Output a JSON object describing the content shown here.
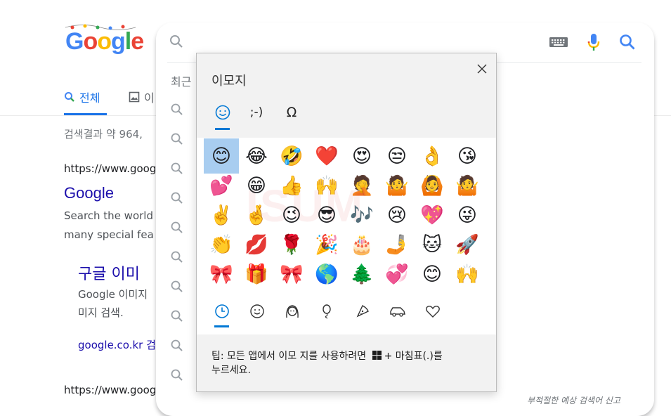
{
  "logo": {
    "letters": [
      "G",
      "o",
      "o",
      "g",
      "l",
      "e"
    ],
    "colors": [
      "#4285f4",
      "#ea4335",
      "#fbbc05",
      "#4285f4",
      "#34a853",
      "#ea4335"
    ]
  },
  "tabs": {
    "all": "전체",
    "images": "이"
  },
  "results": {
    "stats": "검색결과 약 964,",
    "url1": "https://www.goog",
    "title": "Google",
    "snippet1": "Search the world",
    "snippet2": "many special fea",
    "sub_title": "구글 이미",
    "sub_snippet1": "Google 이미지",
    "sub_snippet2": "미지 검색.",
    "sub_link": "google.co.kr 검",
    "url2": "https://www.goog"
  },
  "search": {
    "recent_label": "최근",
    "report": "부적절한 예상 검색어 신고"
  },
  "emoji_panel": {
    "title": "이모지",
    "categories": {
      "emoji": "☺",
      "kaomoji": ";-)",
      "symbols": "Ω"
    },
    "watermark": "ISUM",
    "emojis": [
      "😊",
      "😂",
      "🤣",
      "❤️",
      "😍",
      "😒",
      "👌",
      "😘",
      "💕",
      "😁",
      "👍",
      "🙌",
      "🤦",
      "🤷",
      "🙆",
      "🤷",
      "✌️",
      "🤞",
      "😉",
      "😎",
      "🎶",
      "😢",
      "💖",
      "😜",
      "👏",
      "💋",
      "🌹",
      "🎉",
      "🎂",
      "🤳",
      "🐱",
      "🚀",
      "🎀",
      "🎁",
      "🎀",
      "🌎",
      "🌲",
      "💞",
      "😊",
      "🙌"
    ],
    "groups": [
      "recent-icon",
      "smiley-icon",
      "people-icon",
      "balloon-icon",
      "pizza-icon",
      "car-icon",
      "heart-icon"
    ],
    "tip": "팁: 모든 앱에서 이모 지를 사용하려면",
    "tip_keys": "+ 마침표(.)를",
    "tip_end": "누르세요."
  }
}
